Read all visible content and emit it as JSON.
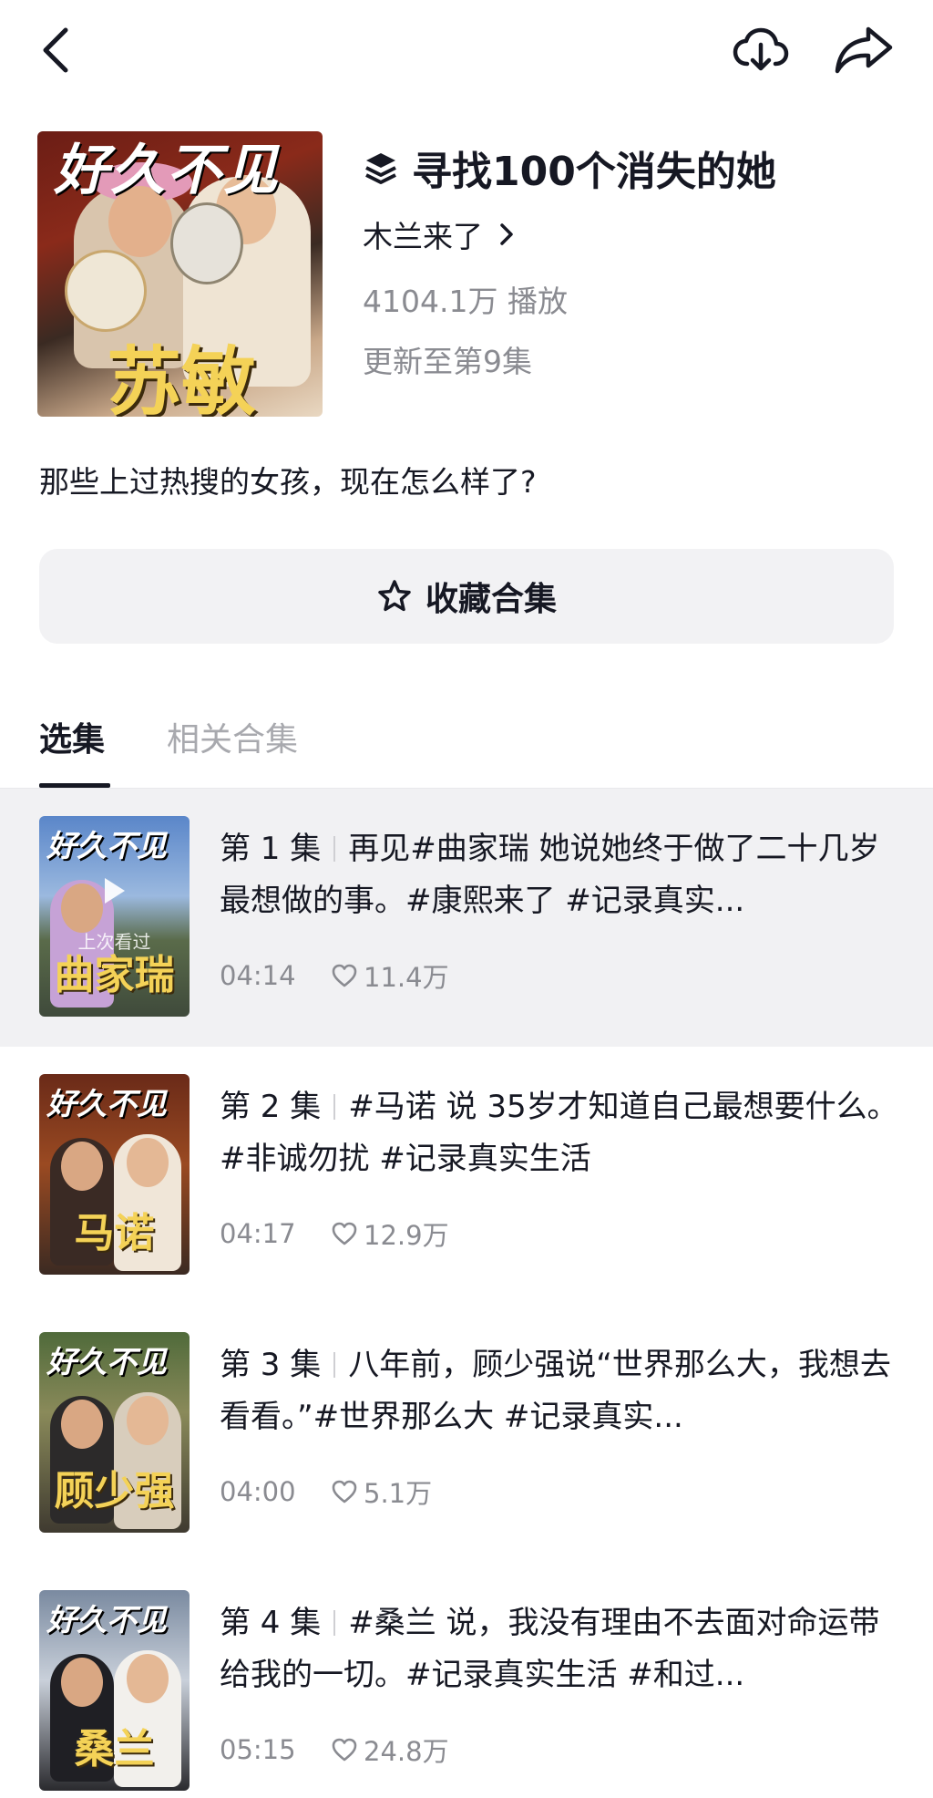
{
  "topbar": {
    "back_icon": "chevron-left-icon",
    "download_icon": "cloud-download-icon",
    "share_icon": "share-arrow-icon"
  },
  "collection": {
    "cover": {
      "title": "好久不见",
      "name": "苏敏"
    },
    "title_icon": "layers-icon",
    "title": "寻找100个消失的她",
    "author": "木兰来了",
    "plays": "4104.1万 播放",
    "update": "更新至第9集",
    "description": "那些上过热搜的女孩，现在怎么样了?"
  },
  "favorite_button": {
    "icon": "star-outline-icon",
    "label": "收藏合集"
  },
  "tabs": [
    {
      "label": "选集",
      "active": true
    },
    {
      "label": "相关合集",
      "active": false
    }
  ],
  "episodes": [
    {
      "number": "第 1 集",
      "text": "再见#曲家瑞 她说她终于做了二十几岁最想做的事。#康熙来了 #记录真实...",
      "duration": "04:14",
      "likes": "11.4万",
      "thumb_title": "好久不见",
      "thumb_name": "曲家瑞",
      "thumb_overlay": "上次看过",
      "current": true
    },
    {
      "number": "第 2 集",
      "text": "#马诺 说 35岁才知道自己最想要什么。#非诚勿扰 #记录真实生活",
      "duration": "04:17",
      "likes": "12.9万",
      "thumb_title": "好久不见",
      "thumb_name": "马诺",
      "current": false
    },
    {
      "number": "第 3 集",
      "text": "八年前，顾少强说“世界那么大，我想去看看。”#世界那么大 #记录真实...",
      "duration": "04:00",
      "likes": "5.1万",
      "thumb_title": "好久不见",
      "thumb_name": "顾少强",
      "current": false
    },
    {
      "number": "第 4 集",
      "text": "#桑兰 说，我没有理由不去面对命运带给我的一切。#记录真实生活 #和过...",
      "duration": "05:15",
      "likes": "24.8万",
      "thumb_title": "好久不见",
      "thumb_name": "桑兰",
      "current": false
    }
  ],
  "colors": {
    "text_primary": "#161823",
    "text_secondary": "#8a8b91",
    "tab_inactive": "#a8a9ae",
    "button_bg": "#f2f2f4",
    "current_row_bg": "#f1f1f3",
    "cover_name_yellow": "#f4d257"
  }
}
